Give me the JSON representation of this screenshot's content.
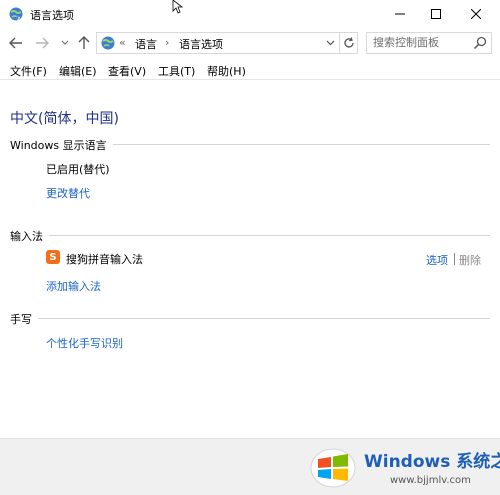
{
  "window": {
    "title": "语言选项"
  },
  "nav": {
    "address": {
      "overflow": "«",
      "crumbs": [
        "语言",
        "语言选项"
      ],
      "sep": "›"
    },
    "search_placeholder": "搜索控制面板"
  },
  "menu": {
    "items": [
      "文件(F)",
      "编辑(E)",
      "查看(V)",
      "工具(T)",
      "帮助(H)"
    ]
  },
  "main": {
    "language_title": "中文(简体，中国)",
    "display_language": {
      "heading": "Windows 显示语言",
      "status": "已启用(替代)",
      "change_link": "更改替代"
    },
    "input_method": {
      "heading": "输入法",
      "ime_icon_letter": "S",
      "ime_name": "搜狗拼音输入法",
      "options_link": "选项",
      "remove_link": "删除",
      "add_link": "添加输入法"
    },
    "handwriting": {
      "heading": "手写",
      "personalize_link": "个性化手写识别"
    }
  },
  "watermark": {
    "title": "Windows 系统之家",
    "url": "www.bjjmlv.com"
  },
  "colors": {
    "link": "#1a64c8",
    "title": "#1e3287",
    "ime_badge": "#f36e17"
  }
}
